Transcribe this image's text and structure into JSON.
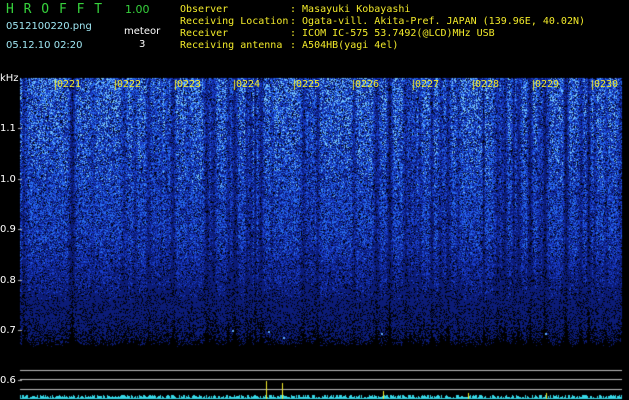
{
  "header": {
    "app_title": "H R O F F T",
    "version": "1.00",
    "filename": "0512100220.png",
    "datetime": "05.12.10 02:20",
    "meteor_label": "meteor",
    "meteor_count": "3",
    "info": [
      {
        "label": "Observer",
        "value": ": Masayuki Kobayashi"
      },
      {
        "label": "Receiving Location",
        "value": ": Ogata-vill. Akita-Pref. JAPAN (139.96E, 40.02N)"
      },
      {
        "label": "Receiver",
        "value": ": ICOM IC-575 53.7492(@LCD)MHz USB"
      },
      {
        "label": "Receiving antenna",
        "value": ": A504HB(yagi 4el)"
      }
    ]
  },
  "spectrogram": {
    "y_unit": "kHz",
    "y_ticks": [
      "1.1",
      "1.0",
      "0.9",
      "0.8",
      "0.7",
      "0.6"
    ],
    "time_ticks": [
      "0221",
      "0222",
      "0223",
      "0224",
      "0225",
      "0226",
      "0227",
      "0228",
      "0229",
      "0230"
    ]
  },
  "colors": {
    "background": "#000000",
    "title_green": "#36d23c",
    "label_yellow": "#f2ea2a",
    "value_cyan": "#9fe6f2",
    "spectrum_blue": "#2a56e0",
    "trace_cyan": "#35d7e6"
  }
}
